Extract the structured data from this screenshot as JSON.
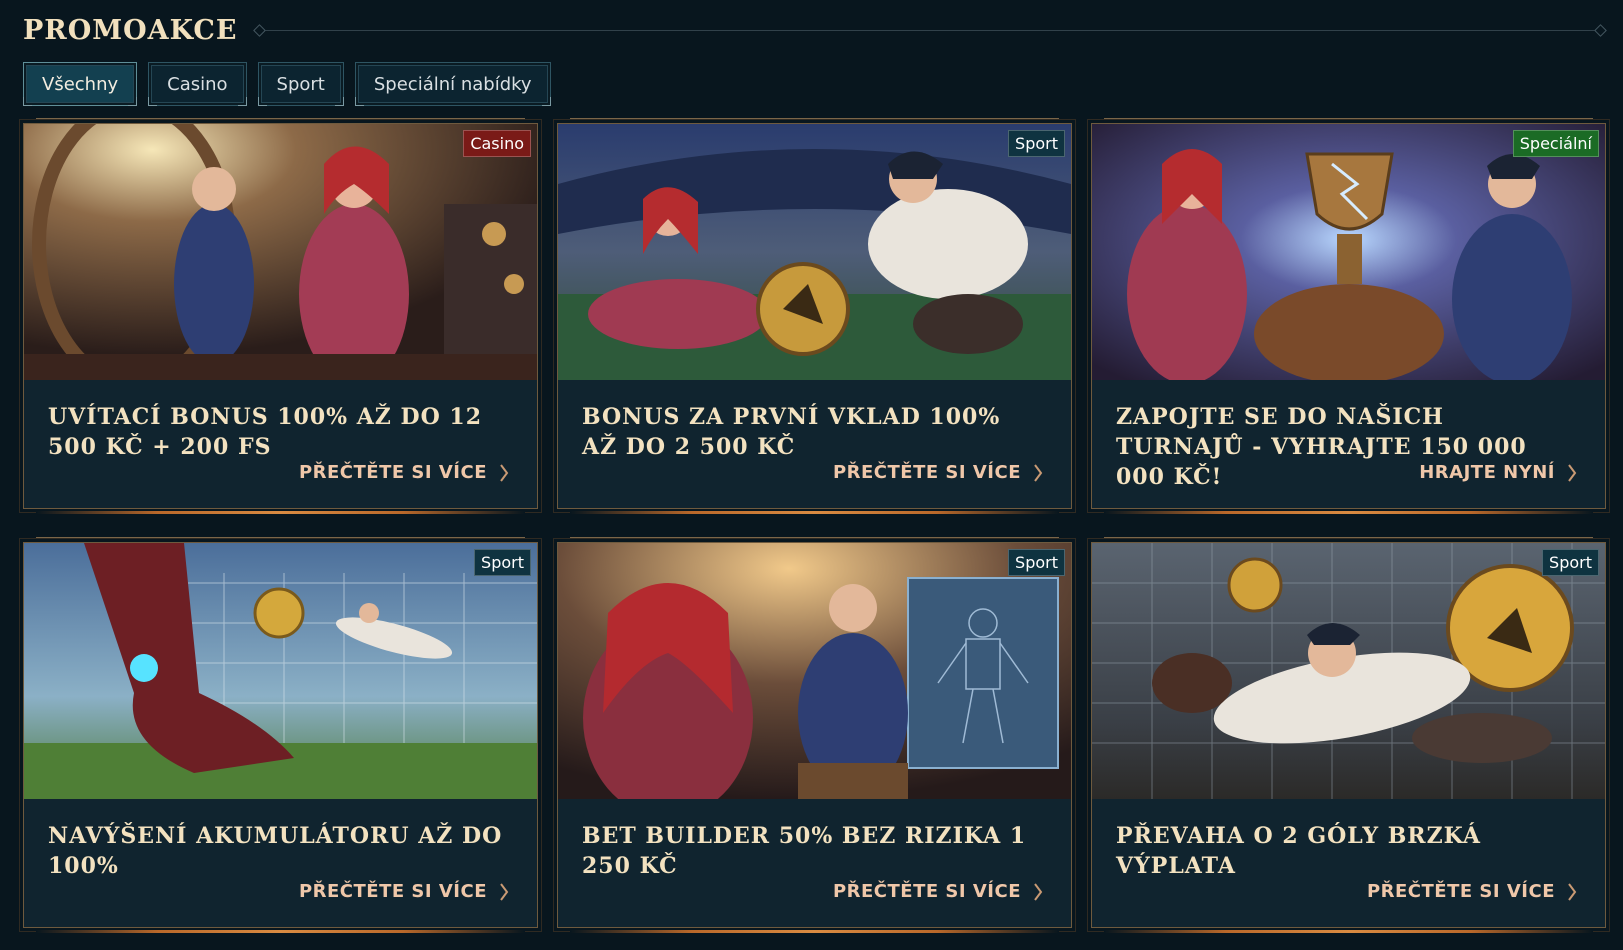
{
  "page": {
    "title": "PROMOAKCE"
  },
  "tabs": [
    {
      "label": "Všechny",
      "active": true
    },
    {
      "label": "Casino",
      "active": false
    },
    {
      "label": "Sport",
      "active": false
    },
    {
      "label": "Speciální nabídky",
      "active": false
    }
  ],
  "colors": {
    "background": "#08161e",
    "card": "#10242f",
    "title_text": "#f3e2c0",
    "link_text": "#efc7a9",
    "badge_casino": "#7a1a17",
    "badge_sport": "#0f3340",
    "badge_special": "#1b6b25",
    "accent_copper": "#d98b42"
  },
  "cards": [
    {
      "badge": "Casino",
      "title": "Uvítací bonus 100% až do 12 500 Kč + 200 FS",
      "link": "PŘEČTĚTE SI VÍCE",
      "image": "steampunk-casino-characters-image"
    },
    {
      "badge": "Sport",
      "title": "Bonus za první vklad 100% až do 2 500 Kč",
      "link": "PŘEČTĚTE SI VÍCE",
      "image": "football-stadium-slide-image"
    },
    {
      "badge": "Speciální",
      "title": "Zapojte se do našich turnajů - vyhrajte 150 000 000 Kč!",
      "link": "HRAJTE NYNÍ",
      "image": "tournament-trophy-image"
    },
    {
      "badge": "Sport",
      "title": "Navýšení akumulátoru až do 100%",
      "link": "PŘEČTĚTE SI VÍCE",
      "image": "goal-kick-image"
    },
    {
      "badge": "Sport",
      "title": "Bet Builder 50% bez rizika 1 250 Kč",
      "link": "PŘEČTĚTE SI VÍCE",
      "image": "blueprint-workshop-image"
    },
    {
      "badge": "Sport",
      "title": "Převaha o 2 góly brzká výplata",
      "link": "PŘEČTĚTE SI VÍCE",
      "image": "goalkeeper-dive-image"
    }
  ]
}
